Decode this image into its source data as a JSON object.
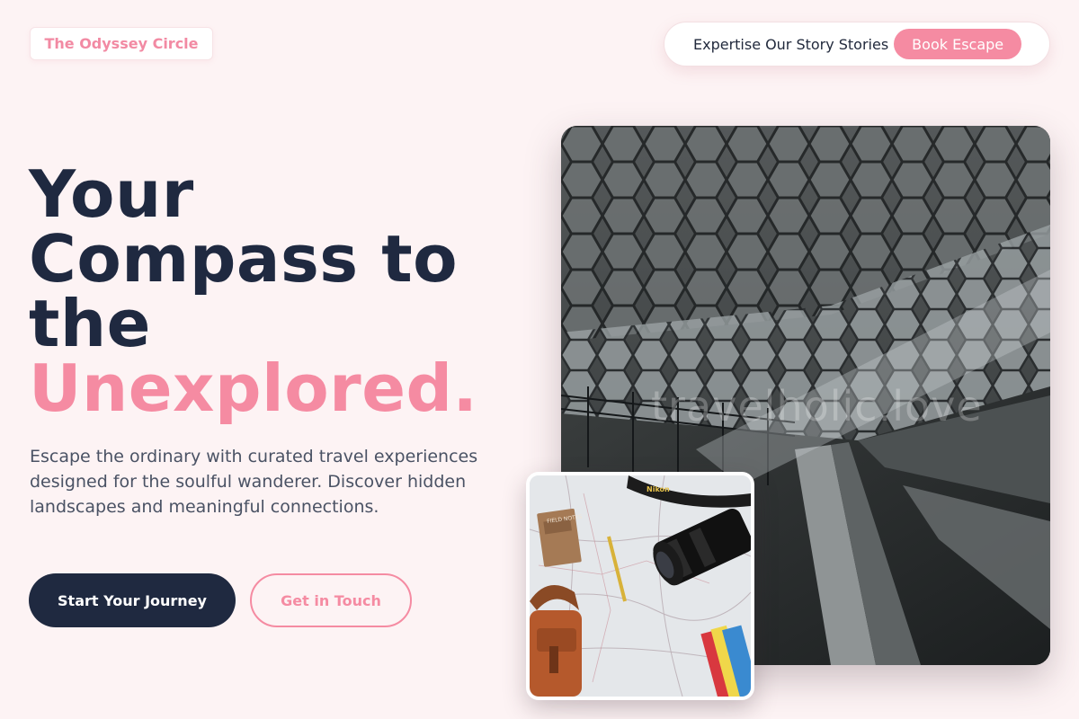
{
  "brand": {
    "name": "The Odyssey Circle"
  },
  "nav": {
    "links": [
      "Expertise",
      "Our Story",
      "Stories"
    ],
    "cta": "Book Escape"
  },
  "hero": {
    "headline_lines": [
      "Your",
      "Compass to",
      "the"
    ],
    "headline_accent": "Unexplored.",
    "lead": "Escape the ordinary with curated travel experiences designed for the soulful wanderer. Discover hidden landscapes and meaningful connections.",
    "primary_button": "Start Your Journey",
    "secondary_button": "Get in Touch"
  },
  "images": {
    "main_watermark": "travelholic.love",
    "small_notebook_text": "FIELD NOTES",
    "small_strap_text": "Nikon"
  },
  "colors": {
    "background": "#fdf3f4",
    "accent": "#f58ba2",
    "dark": "#1f2940"
  }
}
